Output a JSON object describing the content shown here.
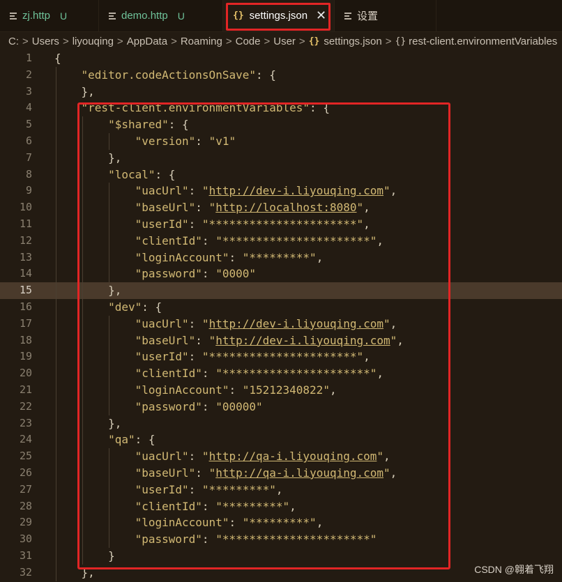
{
  "tabs": [
    {
      "label": "zj.http",
      "badge": "U",
      "icon": "file-lines-icon"
    },
    {
      "label": "demo.http",
      "badge": "U",
      "icon": "file-lines-icon"
    },
    {
      "label": "settings.json",
      "close": "✕",
      "icon": "json-braces-icon"
    },
    {
      "label": "设置",
      "icon": "file-lines-icon"
    }
  ],
  "breadcrumb": {
    "parts": [
      "C:",
      "Users",
      "liyouqing",
      "AppData",
      "Roaming",
      "Code",
      "User"
    ],
    "file": "settings.json",
    "symbol": "rest-client.environmentVariables"
  },
  "editor": {
    "current_line": 15,
    "lines": [
      {
        "n": "1",
        "code": "{"
      },
      {
        "n": "2",
        "code": "    \"editor.codeActionsOnSave\": {"
      },
      {
        "n": "3",
        "code": "    },"
      },
      {
        "n": "4",
        "code": "    \"rest-client.environmentVariables\": {"
      },
      {
        "n": "5",
        "code": "        \"$shared\": {"
      },
      {
        "n": "6",
        "code": "            \"version\": \"v1\""
      },
      {
        "n": "7",
        "code": "        },"
      },
      {
        "n": "8",
        "code": "        \"local\": {"
      },
      {
        "n": "9",
        "code": "            \"uacUrl\": \"http://dev-i.liyouqing.com\","
      },
      {
        "n": "10",
        "code": "            \"baseUrl\": \"http://localhost:8080\","
      },
      {
        "n": "11",
        "code": "            \"userId\": \"**********************\","
      },
      {
        "n": "12",
        "code": "            \"clientId\": \"**********************\","
      },
      {
        "n": "13",
        "code": "            \"loginAccount\": \"*********\","
      },
      {
        "n": "14",
        "code": "            \"password\": \"0000\""
      },
      {
        "n": "15",
        "code": "        },"
      },
      {
        "n": "16",
        "code": "        \"dev\": {"
      },
      {
        "n": "17",
        "code": "            \"uacUrl\": \"http://dev-i.liyouqing.com\","
      },
      {
        "n": "18",
        "code": "            \"baseUrl\": \"http://dev-i.liyouqing.com\","
      },
      {
        "n": "19",
        "code": "            \"userId\": \"**********************\","
      },
      {
        "n": "20",
        "code": "            \"clientId\": \"**********************\","
      },
      {
        "n": "21",
        "code": "            \"loginAccount\": \"15212340822\","
      },
      {
        "n": "22",
        "code": "            \"password\": \"00000\""
      },
      {
        "n": "23",
        "code": "        },"
      },
      {
        "n": "24",
        "code": "        \"qa\": {"
      },
      {
        "n": "25",
        "code": "            \"uacUrl\": \"http://qa-i.liyouqing.com\","
      },
      {
        "n": "26",
        "code": "            \"baseUrl\": \"http://qa-i.liyouqing.com\","
      },
      {
        "n": "27",
        "code": "            \"userId\": \"*********\","
      },
      {
        "n": "28",
        "code": "            \"clientId\": \"*********\","
      },
      {
        "n": "29",
        "code": "            \"loginAccount\": \"*********\","
      },
      {
        "n": "30",
        "code": "            \"password\": \"**********************\""
      },
      {
        "n": "31",
        "code": "        }"
      },
      {
        "n": "32",
        "code": "    },"
      }
    ]
  },
  "watermark": "CSDN @翱着飞翔",
  "colors": {
    "highlight_border": "#e22525",
    "editor_bg": "#231b12",
    "string": "#d2b974"
  }
}
